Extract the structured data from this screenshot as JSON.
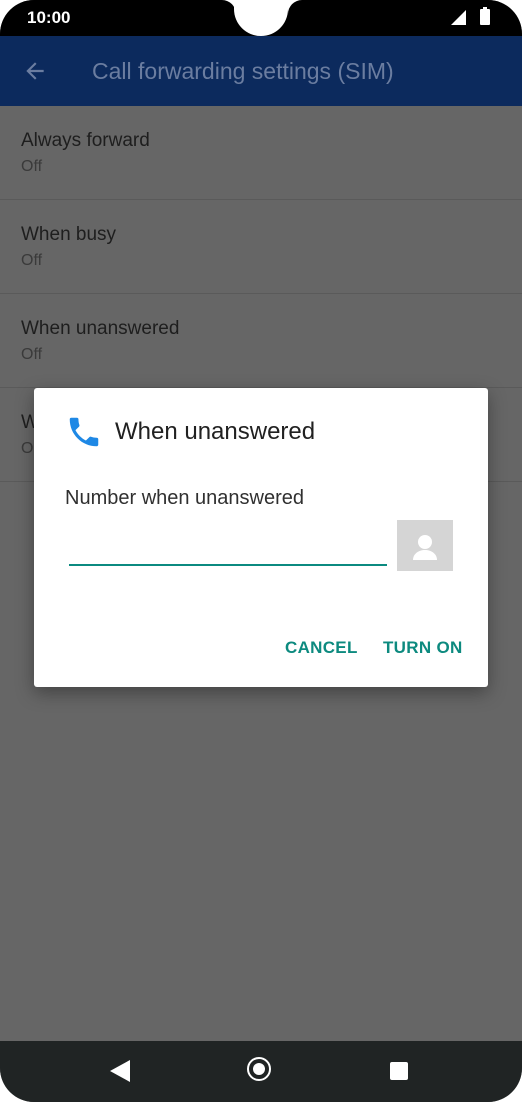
{
  "status_bar": {
    "time": "10:00"
  },
  "app_bar": {
    "title": "Call forwarding settings (SIM)"
  },
  "list": {
    "items": [
      {
        "title": "Always forward",
        "subtitle": "Off"
      },
      {
        "title": "When busy",
        "subtitle": "Off"
      },
      {
        "title": "When unanswered",
        "subtitle": "Off"
      },
      {
        "title": "W",
        "subtitle": "O"
      }
    ]
  },
  "dialog": {
    "title": "When unanswered",
    "label": "Number when unanswered",
    "input_value": "",
    "cancel_label": "CANCEL",
    "confirm_label": "TURN ON"
  },
  "colors": {
    "app_bar": "#0c2a5d",
    "accent": "#0d8a7f",
    "phone_icon": "#1e88e5"
  }
}
